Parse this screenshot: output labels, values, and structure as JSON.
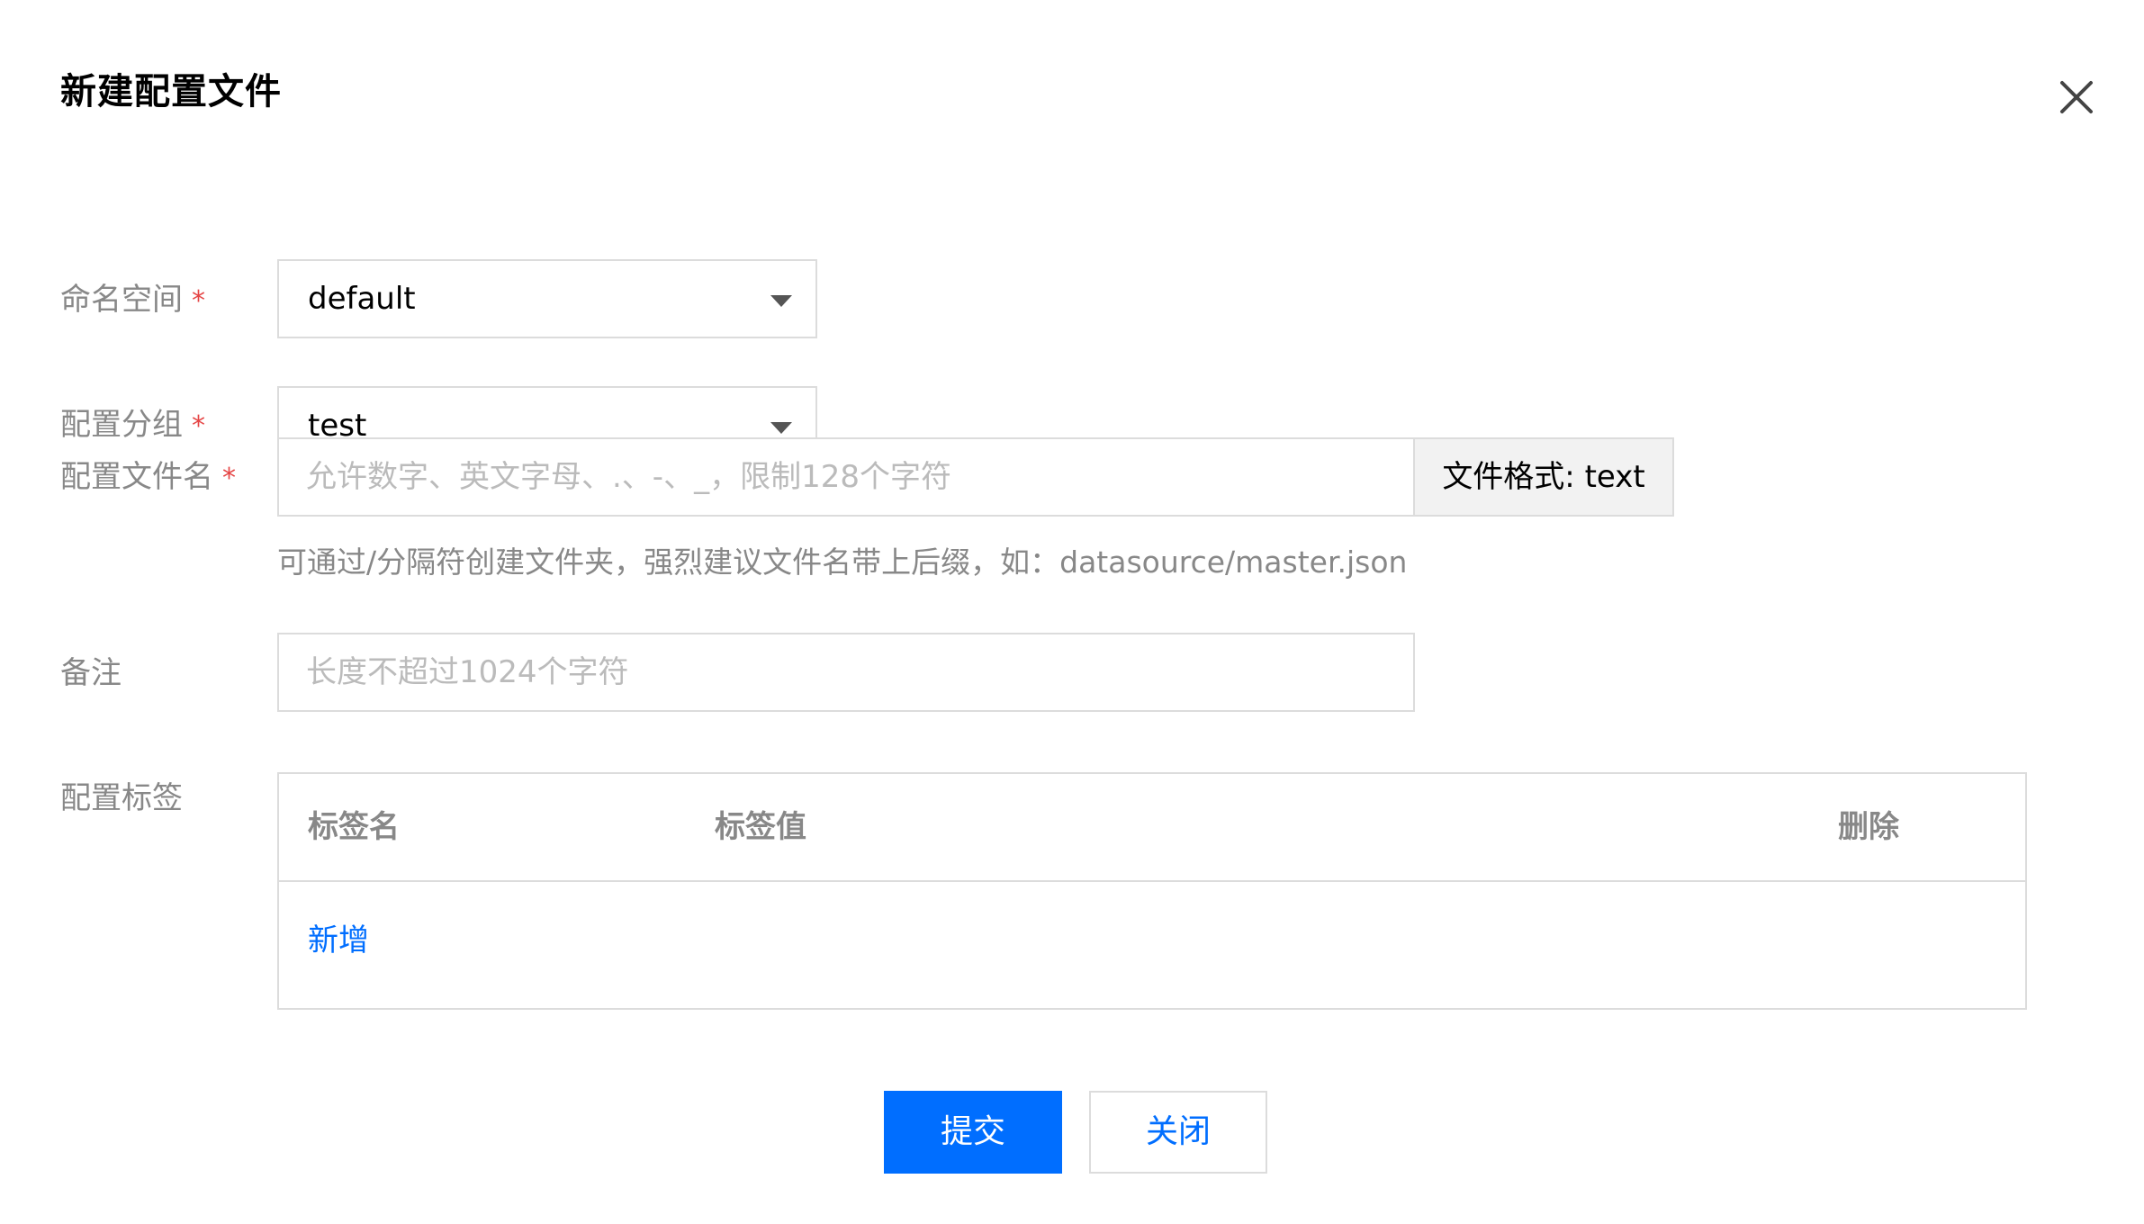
{
  "dialog": {
    "title": "新建配置文件"
  },
  "form": {
    "namespace": {
      "label": "命名空间",
      "required_mark": "*",
      "value": "default"
    },
    "group": {
      "label": "配置分组",
      "required_mark": "*",
      "value": "test"
    },
    "filename": {
      "label": "配置文件名",
      "required_mark": "*",
      "value": "",
      "placeholder": "允许数字、英文字母、.、-、_，限制128个字符",
      "format_addon": "文件格式: text",
      "hint": "可通过/分隔符创建文件夹，强烈建议文件名带上后缀，如：datasource/master.json"
    },
    "remark": {
      "label": "备注",
      "value": "",
      "placeholder": "长度不超过1024个字符"
    },
    "tags": {
      "label": "配置标签",
      "columns": [
        "标签名",
        "标签值",
        "删除"
      ],
      "add_label": "新增"
    }
  },
  "footer": {
    "submit_label": "提交",
    "close_label": "关闭"
  },
  "colors": {
    "primary": "#006eff",
    "required": "#e54545",
    "label": "#888888",
    "border": "#dcdcdc"
  },
  "icons": {
    "close": "close-icon",
    "dropdown": "caret-down-icon"
  }
}
